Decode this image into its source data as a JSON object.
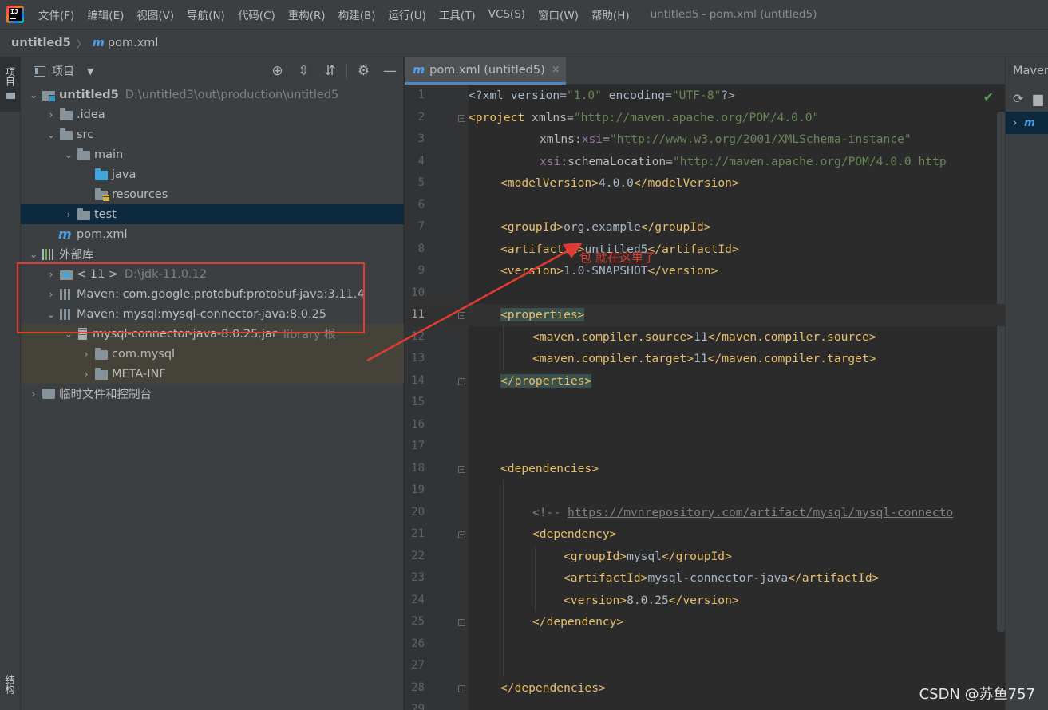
{
  "menubar": {
    "items": [
      "文件(F)",
      "编辑(E)",
      "视图(V)",
      "导航(N)",
      "代码(C)",
      "重构(R)",
      "构建(B)",
      "运行(U)",
      "工具(T)",
      "VCS(S)",
      "窗口(W)",
      "帮助(H)"
    ],
    "window_title": "untitled5 - pom.xml (untitled5)",
    "logo_text": "IJ"
  },
  "breadcrumb": {
    "project": "untitled5",
    "separator": "〉",
    "file_icon": "m",
    "file": "pom.xml"
  },
  "left_stripe": {
    "project_label": "项目",
    "structure_label": "结构"
  },
  "project_panel": {
    "title": "项目",
    "dropdown_arrow": "▼",
    "tools": {
      "locate": "⊕",
      "expand": "⇳",
      "collapse": "⇵",
      "settings": "⚙",
      "hide": "—"
    },
    "tree": {
      "root": {
        "name": "untitled5",
        "path": "D:\\untitled3\\out\\production\\untitled5"
      },
      "idea": ".idea",
      "src": "src",
      "main": "main",
      "java": "java",
      "resources": "resources",
      "test": "test",
      "pom": "pom.xml",
      "external_libs": "外部库",
      "jdk": {
        "name": "< 11 >",
        "path": "D:\\jdk-11.0.12"
      },
      "maven_protobuf": "Maven: com.google.protobuf:protobuf-java:3.11.4",
      "maven_mysql": "Maven: mysql:mysql-connector-java:8.0.25",
      "jar": {
        "name": "mysql-connector-java-8.0.25.jar",
        "suffix": "library 根"
      },
      "com_mysql": "com.mysql",
      "meta_inf": "META-INF",
      "scratches": "临时文件和控制台"
    }
  },
  "editor": {
    "tab_icon": "m",
    "tab_label": "pom.xml (untitled5)",
    "tab_close": "×",
    "annotation": "包 就在这里了",
    "check": "✔"
  },
  "right_panel": {
    "title": "Maven",
    "refresh": "⟳",
    "folder": "▆",
    "expand": "›",
    "row_icon": "m"
  },
  "watermark": "CSDN @苏鱼757",
  "code_lines": [
    {
      "n": "1"
    },
    {
      "n": "2"
    },
    {
      "n": "3"
    },
    {
      "n": "4"
    },
    {
      "n": "5"
    },
    {
      "n": "6"
    },
    {
      "n": "7"
    },
    {
      "n": "8"
    },
    {
      "n": "9"
    },
    {
      "n": "10"
    },
    {
      "n": "11"
    },
    {
      "n": "12"
    },
    {
      "n": "13"
    },
    {
      "n": "14"
    },
    {
      "n": "15"
    },
    {
      "n": "16"
    },
    {
      "n": "17"
    },
    {
      "n": "18"
    },
    {
      "n": "19"
    },
    {
      "n": "20"
    },
    {
      "n": "21"
    },
    {
      "n": "22"
    },
    {
      "n": "23"
    },
    {
      "n": "24"
    },
    {
      "n": "25"
    },
    {
      "n": "26"
    },
    {
      "n": "27"
    },
    {
      "n": "28"
    },
    {
      "n": "29"
    }
  ],
  "code": {
    "l1": {
      "a": "<?xml version=",
      "b": "\"1.0\"",
      "c": " encoding=",
      "d": "\"UTF-8\"",
      "e": "?>"
    },
    "l2": {
      "a": "<project ",
      "b": "xmlns",
      "c": "=",
      "d": "\"http://maven.apache.org/POM/4.0.0\""
    },
    "l3": {
      "a": "xmlns",
      "b": ":",
      "c": "xsi",
      "d": "=",
      "e": "\"http://www.w3.org/2001/XMLSchema-instance\""
    },
    "l4": {
      "a": "xsi",
      "b": ":schemaLocation",
      "c": "=",
      "d": "\"http://maven.apache.org/POM/4.0.0 http"
    },
    "l5": {
      "a": "<modelVersion>",
      "b": "4.0.0",
      "c": "</modelVersion>"
    },
    "l7": {
      "a": "<groupId>",
      "b": "org.example",
      "c": "</groupId>"
    },
    "l8": {
      "a": "<artifactId>",
      "b": "untitled5",
      "c": "</artifactId>"
    },
    "l9": {
      "a": "<version>",
      "b": "1.0-SNAPSHOT",
      "c": "</version>"
    },
    "l11": {
      "a": "<properties>"
    },
    "l12": {
      "a": "<maven.compiler.source>",
      "b": "11",
      "c": "</maven.compiler.source>"
    },
    "l13": {
      "a": "<maven.compiler.target>",
      "b": "11",
      "c": "</maven.compiler.target>"
    },
    "l14": {
      "a": "</properties>"
    },
    "l18": {
      "a": "<dependencies>"
    },
    "l20": {
      "a": "<!-- ",
      "b": "https://mvnrepository.com/artifact/mysql/mysql-connecto"
    },
    "l21": {
      "a": "<dependency>"
    },
    "l22": {
      "a": "<groupId>",
      "b": "mysql",
      "c": "</groupId>"
    },
    "l23": {
      "a": "<artifactId>",
      "b": "mysql-connector-java",
      "c": "</artifactId>"
    },
    "l24": {
      "a": "<version>",
      "b": "8.0.25",
      "c": "</version>"
    },
    "l25": {
      "a": "</dependency>"
    },
    "l28": {
      "a": "</dependencies>"
    }
  }
}
